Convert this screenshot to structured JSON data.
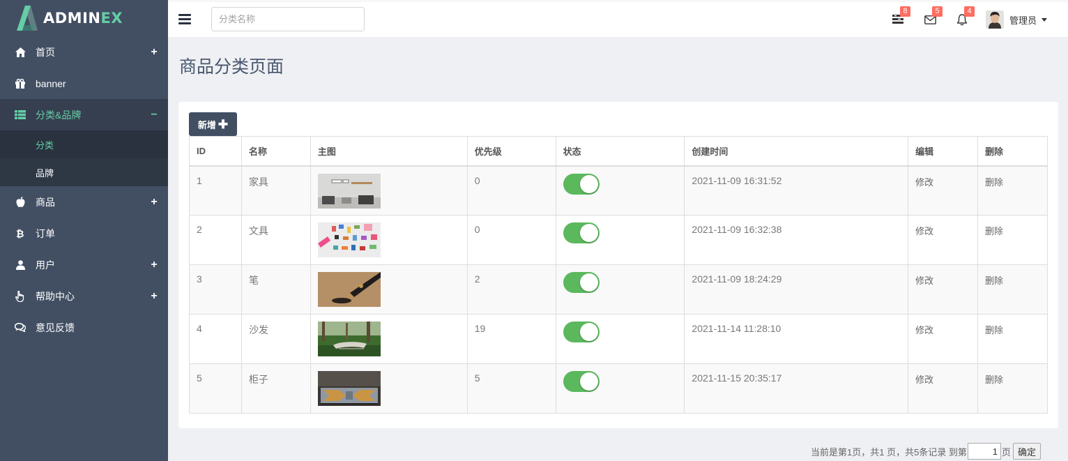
{
  "brand": {
    "text_main": "ADMIN",
    "text_accent": "EX",
    "accent_color": "#65cea7",
    "sidebar_color": "#424f63"
  },
  "sidebar": {
    "items": [
      {
        "label": "首页",
        "icon": "home-icon",
        "toggle": "+"
      },
      {
        "label": "banner",
        "icon": "gift-icon",
        "toggle": ""
      },
      {
        "label": "分类&品牌",
        "icon": "table-list-icon",
        "toggle": "−",
        "expanded": true,
        "children": [
          {
            "label": "分类",
            "active": true
          },
          {
            "label": "品牌",
            "active": false
          }
        ]
      },
      {
        "label": "商品",
        "icon": "apple-icon",
        "toggle": "+"
      },
      {
        "label": "订单",
        "icon": "bitcoin-icon",
        "toggle": ""
      },
      {
        "label": "用户",
        "icon": "user-icon",
        "toggle": "+"
      },
      {
        "label": "帮助中心",
        "icon": "hand-pointer-icon",
        "toggle": "+"
      },
      {
        "label": "意见反馈",
        "icon": "comments-icon",
        "toggle": ""
      }
    ]
  },
  "header": {
    "search_placeholder": "分类名称",
    "tasks_badge": "8",
    "mail_badge": "5",
    "notifications_badge": "4",
    "user_name": "管理员"
  },
  "page": {
    "title": "商品分类页面",
    "add_label": "新增"
  },
  "table": {
    "columns": [
      "ID",
      "名称",
      "主图",
      "优先级",
      "状态",
      "创建时间",
      "编辑",
      "删除"
    ],
    "rows": [
      {
        "id": "1",
        "name": "家具",
        "priority": "0",
        "status": true,
        "created": "2021-11-09 16:31:52",
        "edit": "修改",
        "delete": "删除",
        "thumb": "furniture-photo"
      },
      {
        "id": "2",
        "name": "文具",
        "priority": "0",
        "status": true,
        "created": "2021-11-09 16:32:38",
        "edit": "修改",
        "delete": "删除",
        "thumb": "stationery-photo"
      },
      {
        "id": "3",
        "name": "笔",
        "priority": "2",
        "status": true,
        "created": "2021-11-09 18:24:29",
        "edit": "修改",
        "delete": "删除",
        "thumb": "pen-photo"
      },
      {
        "id": "4",
        "name": "沙发",
        "priority": "19",
        "status": true,
        "created": "2021-11-14 11:28:10",
        "edit": "修改",
        "delete": "删除",
        "thumb": "sofa-photo"
      },
      {
        "id": "5",
        "name": "柜子",
        "priority": "5",
        "status": true,
        "created": "2021-11-15 20:35:17",
        "edit": "修改",
        "delete": "删除",
        "thumb": "cabinet-photo"
      }
    ]
  },
  "pagination": {
    "summary": "当前是第1页，共1 页，共5条记录 到第",
    "page_value": "1",
    "page_suffix": "页",
    "confirm": "确定"
  }
}
